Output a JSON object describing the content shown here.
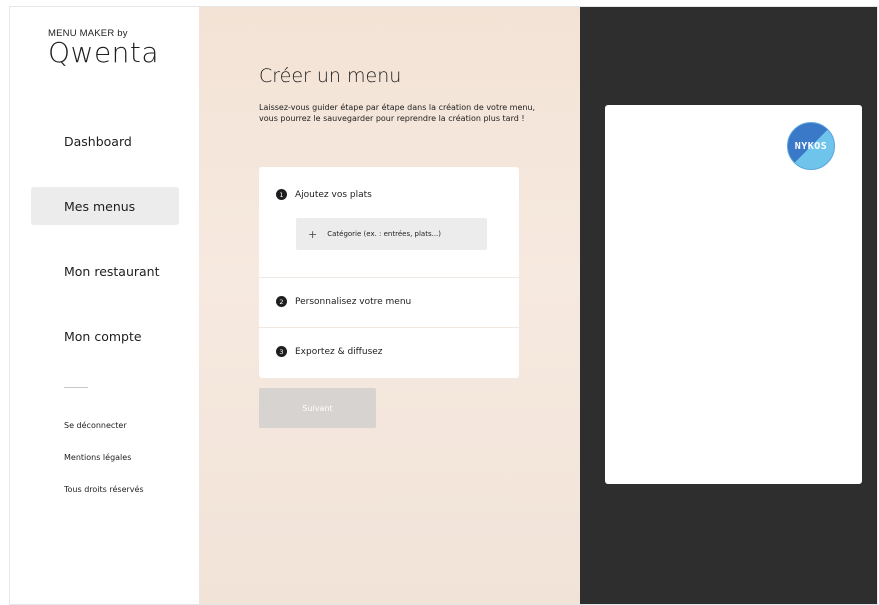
{
  "brand": {
    "prefix": "MENU MAKER by",
    "name": "Qwenta"
  },
  "sidebar": {
    "items": [
      {
        "label": "Dashboard",
        "active": false
      },
      {
        "label": "Mes menus",
        "active": true
      },
      {
        "label": "Mon restaurant",
        "active": false
      },
      {
        "label": "Mon compte",
        "active": false
      }
    ],
    "footer_links": [
      {
        "label": "Se déconnecter"
      },
      {
        "label": "Mentions légales"
      },
      {
        "label": "Tous droits réservés"
      }
    ]
  },
  "main": {
    "title": "Créer un menu",
    "intro": "Laissez-vous guider étape par étape dans la création de votre menu, vous pourrez le sauvegarder pour reprendre la création plus tard !",
    "steps": [
      {
        "number": "1",
        "label": "Ajoutez vos plats"
      },
      {
        "number": "2",
        "label": "Personnalisez votre menu"
      },
      {
        "number": "3",
        "label": "Exportez & diffusez"
      }
    ],
    "category_button": {
      "plus": "+",
      "label": "Catégorie (ex. : entrées, plats...)"
    },
    "next_button": "Suivant"
  },
  "preview": {
    "logo_text": "NYKOS"
  },
  "colors": {
    "accent_active_nav": "#ececec",
    "middle_bg": "#f3e3d6",
    "right_bg": "#2e2e2e",
    "next_button_disabled": "#d6d3d0",
    "logo_blue": "#3a78c8",
    "logo_light_blue": "#6fc4ec"
  }
}
